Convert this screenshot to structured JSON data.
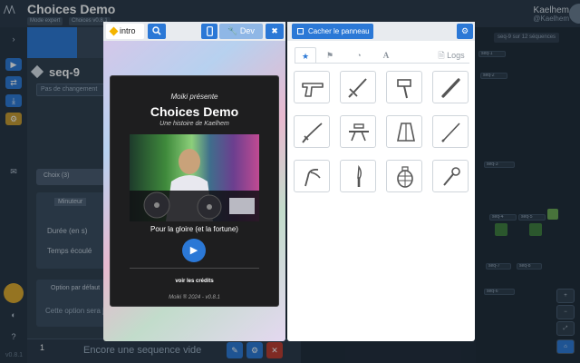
{
  "app": {
    "title": "Choices Demo",
    "chip_1": "Mode expert",
    "chip_2": "Choices v0.8.1",
    "user_name": "Kaelhem",
    "user_handle": "@Kaelhem",
    "version": "v0.8.1"
  },
  "rail": {
    "items": [
      "›",
      "▶",
      "⇄",
      "⤓",
      "⚙",
      "✉",
      "◐",
      "?"
    ]
  },
  "left_panel": {
    "seq_title": "seq-9",
    "seq_input": "Pas de changement",
    "card_choices": "Choix (3)",
    "card_timer": "Minuteur",
    "field_duration": "Durée (en s)",
    "field_elapsed": "Temps écoulé",
    "card_auto": "Option par défaut",
    "field_auto": "Cette option sera jouée"
  },
  "sequence_bar": {
    "number": "1",
    "empty_label": "Encore une sequence vide"
  },
  "graph": {
    "chip": "seq-9 sur 12 séquences",
    "nodes": [
      "seq-1",
      "seq-2",
      "seq-3",
      "seq-4",
      "seq-5",
      "seq-6",
      "seq-7",
      "seq-8"
    ],
    "tools": [
      "+",
      "−",
      "⤢",
      "⌂"
    ]
  },
  "preview": {
    "scene_label": "intro",
    "dev_label": "Dev",
    "presents": "Moiki présente",
    "game_title": "Choices Demo",
    "subtitle": "Une histoire de Kaelhem",
    "tagline": "Pour la gloire (et la fortune)",
    "credits": "voir les crédits",
    "footer": "Moiki ® 2024 - v0.8.1"
  },
  "panel": {
    "hide_label": "Cacher le panneau",
    "tabs": [
      {
        "icon": "star-icon",
        "label": ""
      },
      {
        "icon": "flag-icon",
        "label": ""
      },
      {
        "icon": "gauge-icon",
        "label": ""
      },
      {
        "icon": "font-icon",
        "label": ""
      },
      {
        "icon": "file-icon",
        "label": "Logs"
      }
    ],
    "icons": [
      "pistol-icon",
      "sword-icon",
      "hammer-icon",
      "club-icon",
      "katana-icon",
      "sniper-rifle-icon",
      "axe-icon",
      "sabre-icon",
      "slingshot-icon",
      "knife-icon",
      "grenade-icon",
      "mace-icon"
    ]
  },
  "colors": {
    "accent": "#2b78d6",
    "danger": "#c0392b",
    "background": "#1f2a36",
    "scene_marker": "#f4b400"
  }
}
